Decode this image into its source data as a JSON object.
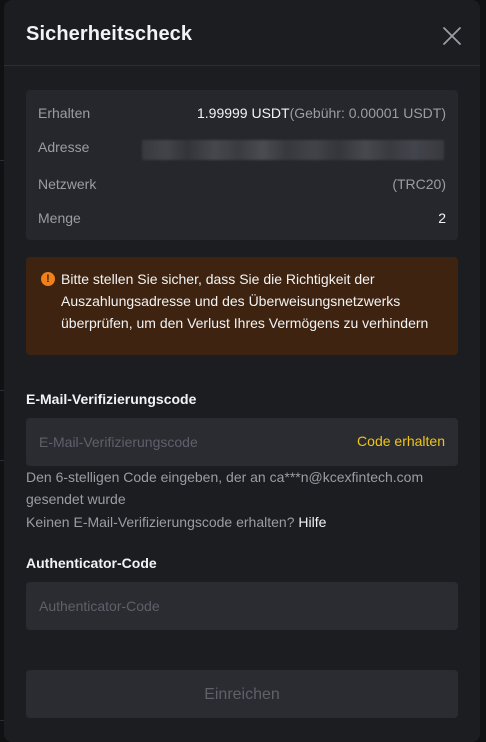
{
  "dialog": {
    "title": "Sicherheitscheck"
  },
  "summary": {
    "receive_label": "Erhalten",
    "receive_amount": "1.99999 USDT",
    "receive_fee": "(Gebühr: 0.00001 USDT)",
    "address_label": "Adresse",
    "network_label": "Netzwerk",
    "network_value": "(TRC20)",
    "quantity_label": "Menge",
    "quantity_value": "2"
  },
  "warning": {
    "text": "Bitte stellen Sie sicher, dass Sie die Richtigkeit der Auszahlungsadresse und des Überweisungsnetzwerks überprüfen, um den Verlust Ihres Vermögens zu verhindern",
    "icon_glyph": "!"
  },
  "email_code": {
    "label": "E-Mail-Verifizierungscode",
    "placeholder": "E-Mail-Verifizierungscode",
    "get_code_label": "Code erhalten",
    "hint": "Den 6-stelligen Code eingeben, der an ca***n@kcexfintech.com gesendet wurde",
    "not_received": "Keinen E-Mail-Verifizierungscode erhalten?",
    "help_label": "Hilfe"
  },
  "authenticator": {
    "label": "Authenticator-Code",
    "placeholder": "Authenticator-Code"
  },
  "submit_label": "Einreichen",
  "colors": {
    "accent": "#f0c419",
    "warning_bg": "#3e2410",
    "warning_icon": "#f0801a",
    "panel_bg": "#1c1d21"
  }
}
